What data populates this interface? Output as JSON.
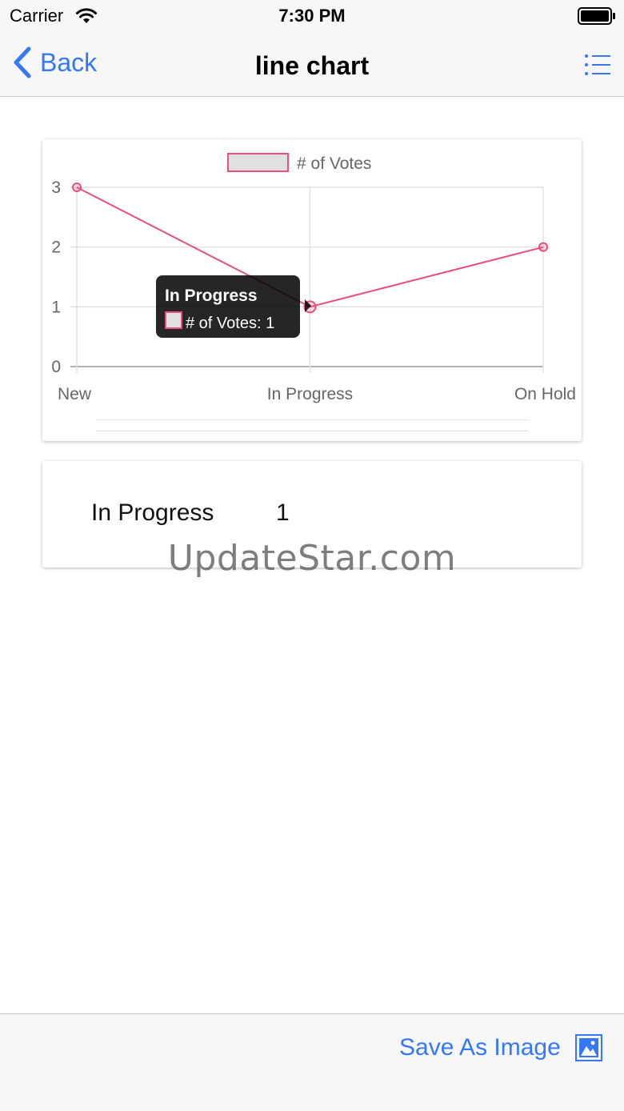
{
  "status_bar": {
    "carrier": "Carrier",
    "time": "7:30 PM"
  },
  "nav": {
    "back_label": "Back",
    "title": "line chart"
  },
  "chart_data": {
    "type": "line",
    "categories": [
      "New",
      "In Progress",
      "On Hold"
    ],
    "series": [
      {
        "name": "# of Votes",
        "values": [
          3,
          1,
          2
        ]
      }
    ],
    "y_ticks": [
      "0",
      "1",
      "2",
      "3"
    ],
    "ylim": [
      0,
      3
    ],
    "legend": "top",
    "grid": true,
    "line_color": "#e8507a",
    "legend_fill": "#e0e0e0",
    "tooltip": {
      "title": "In Progress",
      "body": "# of Votes: 1"
    }
  },
  "detail": {
    "label": "In Progress",
    "value": "1"
  },
  "watermark": "UpdateStar.com",
  "footer": {
    "save_label": "Save As Image"
  },
  "colors": {
    "accent": "#3478f6",
    "bar_bg": "#f7f7f7"
  }
}
